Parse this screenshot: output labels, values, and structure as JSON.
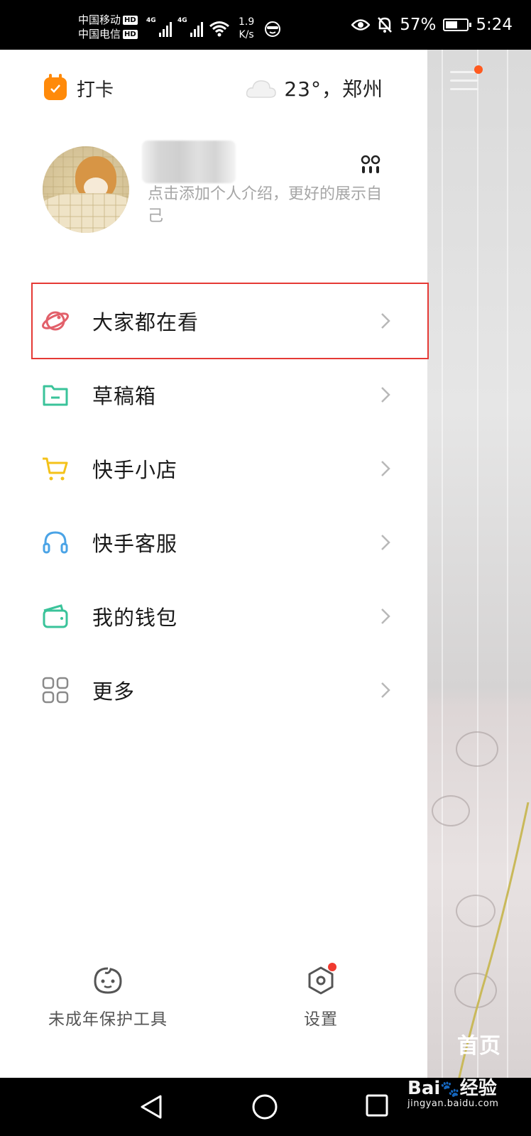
{
  "status_bar": {
    "carrier_1": "中国移动",
    "carrier_2": "中国电信",
    "hd_badge": "HD",
    "network_1": "4G",
    "network_2": "4G",
    "speed_value": "1.9",
    "speed_unit": "K/s",
    "battery_text": "57%",
    "battery_level": 0.57,
    "time": "5:24"
  },
  "drawer": {
    "checkin_label": "打卡",
    "weather_text": "23°，郑州",
    "profile": {
      "bio_placeholder": "点击添加个人介绍，更好的展示自己"
    },
    "menu_items": [
      {
        "label": "大家都在看",
        "icon": "planet-icon",
        "color": "#e2606a",
        "highlighted": true
      },
      {
        "label": "草稿箱",
        "icon": "folder-icon",
        "color": "#3ac39a"
      },
      {
        "label": "快手小店",
        "icon": "cart-icon",
        "color": "#f4c21a"
      },
      {
        "label": "快手客服",
        "icon": "headset-icon",
        "color": "#4aa3e6"
      },
      {
        "label": "我的钱包",
        "icon": "wallet-icon",
        "color": "#3ac39a"
      },
      {
        "label": "更多",
        "icon": "grid-icon",
        "color": "#8a8a8a"
      }
    ],
    "bottom": {
      "minor_protection_label": "未成年保护工具",
      "settings_label": "设置"
    }
  },
  "background": {
    "home_label": "首页"
  },
  "watermark": {
    "brand": "Bai",
    "brand_suffix": "经验",
    "domain": "jingyan.baidu.com"
  },
  "colors": {
    "highlight_border": "#e53935",
    "checkin_orange": "#ff8a0a",
    "notification_red": "#f03a2f"
  }
}
